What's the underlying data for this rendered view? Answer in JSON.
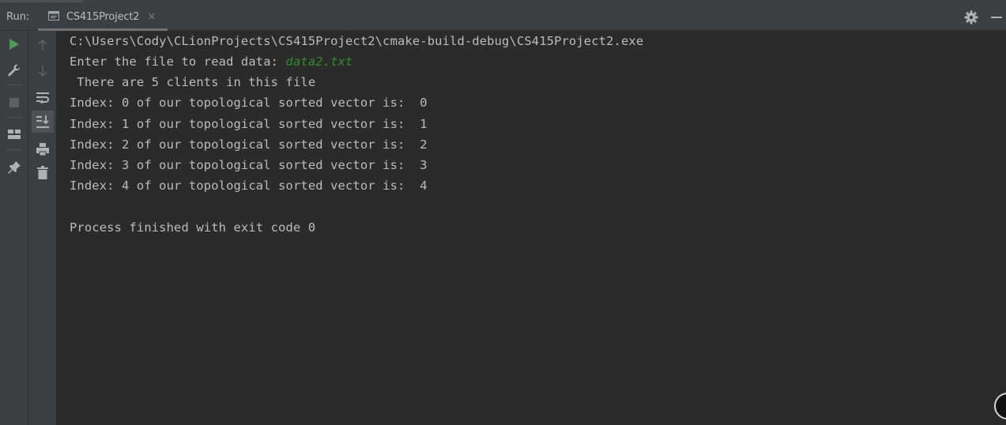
{
  "header": {
    "run_label": "Run:",
    "tab_label": "CS415Project2",
    "tab_close": "×",
    "settings_icon": "gear-icon",
    "minimize_icon": "minimize-icon"
  },
  "toolbar_left": {
    "icons": [
      "run-icon",
      "wrench-icon",
      "stop-icon",
      "layout-icon",
      "pin-icon"
    ]
  },
  "toolbar_right": {
    "icons": [
      "up-arrow-icon",
      "down-arrow-icon",
      "soft-wrap-icon",
      "scroll-to-end-icon",
      "print-icon",
      "trash-icon"
    ]
  },
  "colors": {
    "background": "#2b2b2b",
    "panel": "#3c3f41",
    "run_green": "#499c54",
    "input_green": "#328c2c",
    "text": "#bbbbbb"
  },
  "console": {
    "path": "C:\\Users\\Cody\\CLionProjects\\CS415Project2\\cmake-build-debug\\CS415Project2.exe",
    "prompt": "Enter the file to read data: ",
    "input_value": "data2.txt",
    "clients_line": " There are 5 clients in this file",
    "index_lines": [
      "Index: 0 of our topological sorted vector is:  0",
      "Index: 1 of our topological sorted vector is:  1",
      "Index: 2 of our topological sorted vector is:  2",
      "Index: 3 of our topological sorted vector is:  3",
      "Index: 4 of our topological sorted vector is:  4"
    ],
    "exit_line": "Process finished with exit code 0"
  }
}
